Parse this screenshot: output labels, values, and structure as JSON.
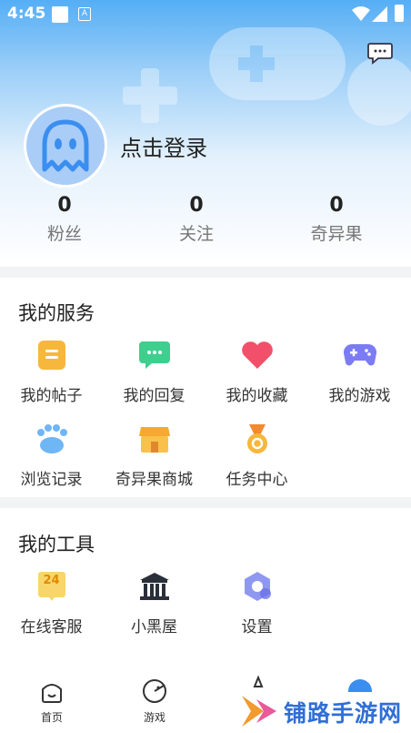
{
  "status_bar": {
    "time": "4:45",
    "a_label": "A"
  },
  "profile": {
    "login_label": "点击登录"
  },
  "stats": [
    {
      "value": "0",
      "label": "粉丝"
    },
    {
      "value": "0",
      "label": "关注"
    },
    {
      "value": "0",
      "label": "奇异果"
    }
  ],
  "services": {
    "title": "我的服务",
    "items": [
      {
        "label": "我的帖子",
        "icon": "document-icon"
      },
      {
        "label": "我的回复",
        "icon": "chat-icon"
      },
      {
        "label": "我的收藏",
        "icon": "heart-icon"
      },
      {
        "label": "我的游戏",
        "icon": "gamepad-icon"
      },
      {
        "label": "浏览记录",
        "icon": "paw-icon"
      },
      {
        "label": "奇异果商城",
        "icon": "store-icon"
      },
      {
        "label": "任务中心",
        "icon": "medal-icon"
      }
    ]
  },
  "tools": {
    "title": "我的工具",
    "items": [
      {
        "label": "在线客服",
        "icon": "support-24-icon",
        "badge": "24"
      },
      {
        "label": "小黑屋",
        "icon": "house-icon"
      },
      {
        "label": "设置",
        "icon": "settings-icon"
      }
    ]
  },
  "bottom_nav": [
    {
      "label": "首页",
      "icon": "home-icon"
    },
    {
      "label": "游戏",
      "icon": "game-icon"
    }
  ],
  "watermark": {
    "text": "铺路手游网"
  },
  "colors": {
    "accent": "#3a8ef0",
    "header_top": "#55aef5",
    "avatar_bg": "#a9cdf7"
  }
}
